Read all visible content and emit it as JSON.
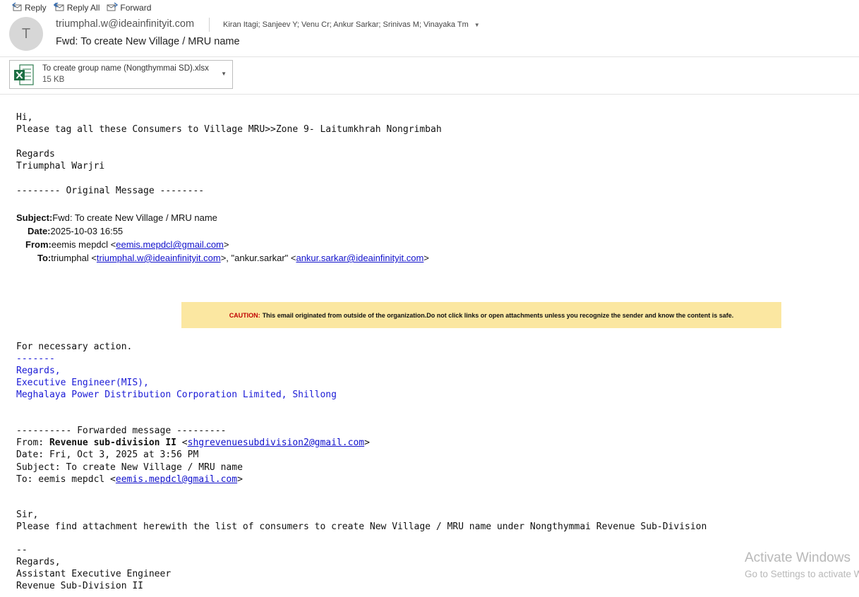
{
  "toolbar": {
    "reply": "Reply",
    "reply_all": "Reply All",
    "forward": "Forward"
  },
  "header": {
    "avatar_initial": "T",
    "sender": "triumphal.w@ideainfinityit.com",
    "subject": "Fwd: To create New Village / MRU name",
    "recipients": "Kiran Itagi; Sanjeev Y; Venu Cr; Ankur Sarkar; Srinivas M; Vinayaka Tm"
  },
  "attachment": {
    "name": "To create group name (Nongthymmai SD).xlsx",
    "size": "15 KB",
    "icon": "excel-icon"
  },
  "body": {
    "greeting": "Hi,",
    "line1": "Please tag all these Consumers to Village MRU>>Zone 9- Laitumkhrah Nongrimbah",
    "regards": "Regards",
    "signature": "Triumphal Warjri",
    "orig_sep": "-------- Original Message --------"
  },
  "original": {
    "subject_label": "Subject:",
    "subject": "Fwd: To create New Village / MRU name",
    "date_label": "Date:",
    "date": "2025-10-03 16:55",
    "from_label": "From:",
    "from_name": "eemis mepdcl <",
    "from_email": "eemis.mepdcl@gmail.com",
    "from_close": ">",
    "to_label": "To:",
    "to_name1": "triumphal <",
    "to_email1": "triumphal.w@ideainfinityit.com",
    "to_mid": ">, \"ankur.sarkar\" <",
    "to_email2": "ankur.sarkar@ideainfinityit.com",
    "to_close": ">"
  },
  "caution": {
    "label": "CAUTION:",
    "text": "This email originated from outside of the organization.Do not click links or open attachments unless you recognize the sender and know the content is safe."
  },
  "fwd1": {
    "action": "For necessary action.",
    "dashes": "-------",
    "regards": "Regards,",
    "title": "Executive Engineer(MIS),",
    "org": "Meghalaya Power Distribution Corporation Limited, Shillong"
  },
  "fwd2": {
    "sep": "---------- Forwarded message ---------",
    "from_label": "From: ",
    "from_name": "Revenue sub-division II",
    "from_open": " <",
    "from_email": "shgrevenuesubdivision2@gmail.com",
    "from_close": ">",
    "date": "Date: Fri, Oct 3, 2025 at 3:56 PM",
    "subject": "Subject: To create New Village / MRU name",
    "to_label": "To: eemis mepdcl <",
    "to_email": "eemis.mepdcl@gmail.com",
    "to_close": ">",
    "sir": "Sir,",
    "line": "Please find attachment herewith the list of consumers to create New Village / MRU name under Nongthymmai Revenue Sub-Division",
    "dd": "--",
    "regards": "Regards,",
    "sig1": "Assistant Executive Engineer",
    "sig2": "Revenue Sub-Division II"
  },
  "watermark": {
    "line1": "Activate Windows",
    "line2": "Go to Settings to activate Windows."
  },
  "colors": {
    "caution_bg": "#fbe7a1",
    "caution_label": "#c00000",
    "link": "#1111cc",
    "signature_blue": "#1a1ad6"
  }
}
